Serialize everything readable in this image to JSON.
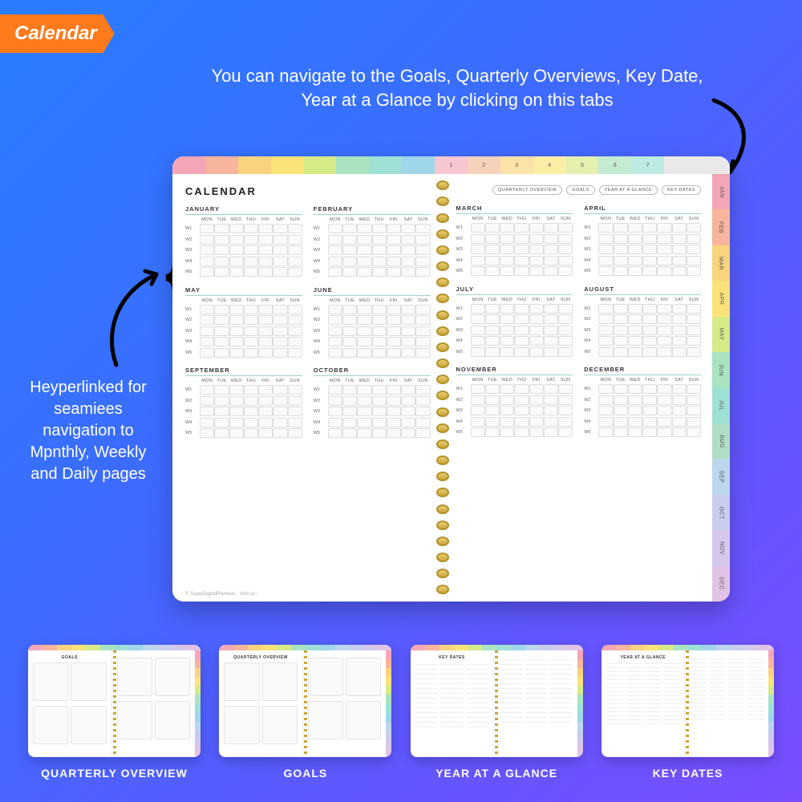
{
  "tag": "Calendar",
  "blurb_top": "You can navigate to the Goals, Quarterly Overviews, Key Date, Year at a Glance by clicking on this tabs",
  "blurb_left": "Heyperlinked for seamiees navigation to Mpnthly, Weekly and Daily pages",
  "planner": {
    "title": "CALENDAR",
    "nav_pills": [
      "QUARTERLY OVERVIEW",
      "GOALS",
      "YEAR AT A GLANCE",
      "KEY DATES"
    ],
    "dow": [
      "MON",
      "TUE",
      "WED",
      "THU",
      "FRI",
      "SAT",
      "SUN"
    ],
    "weeks": [
      "W1",
      "W2",
      "W3",
      "W4",
      "W5"
    ],
    "top_tabs": [
      {
        "color": "#f4a6b7"
      },
      {
        "color": "#f6b59c"
      },
      {
        "color": "#f9d37e"
      },
      {
        "color": "#fbe37a"
      },
      {
        "color": "#d6ea88"
      },
      {
        "color": "#a9e3c0"
      },
      {
        "color": "#9ee0d6"
      },
      {
        "color": "#9fd6ea"
      },
      {
        "color": "#f7c7d1",
        "label": "1"
      },
      {
        "color": "#f7d2bb",
        "label": "2"
      },
      {
        "color": "#fbe2a8",
        "label": "3"
      },
      {
        "color": "#fdeea6",
        "label": "4"
      },
      {
        "color": "#e3f0b0",
        "label": "5"
      },
      {
        "color": "#c4ecd3",
        "label": "6"
      },
      {
        "color": "#bdeae3",
        "label": "7"
      },
      {
        "color": "#e9e9e9"
      },
      {
        "color": "#e9e9e9"
      }
    ],
    "side_tabs": [
      {
        "label": "JAN",
        "color": "#f4a6b7"
      },
      {
        "label": "FEB",
        "color": "#f6b59c"
      },
      {
        "label": "MAR",
        "color": "#f9d37e"
      },
      {
        "label": "APR",
        "color": "#fbe37a"
      },
      {
        "label": "MAY",
        "color": "#d6ea88"
      },
      {
        "label": "JUN",
        "color": "#a9e3c0"
      },
      {
        "label": "JUL",
        "color": "#9ee0d6"
      },
      {
        "label": "AUG",
        "color": "#b0dec5"
      },
      {
        "label": "SEP",
        "color": "#bcd6ec"
      },
      {
        "label": "OCT",
        "color": "#c7cdeb"
      },
      {
        "label": "NOV",
        "color": "#d5c7ea"
      },
      {
        "label": "DEC",
        "color": "#e2c3e6"
      }
    ],
    "left_months": [
      "JANUARY",
      "FEBRUARY",
      "MAY",
      "JUNE",
      "SEPTEMBER",
      "OCTOBER"
    ],
    "right_months": [
      "MARCH",
      "APRIL",
      "JULY",
      "AUGUST",
      "NOVEMBER",
      "DECEMBER"
    ],
    "footer": "© SuperDigitalPlanners · Visit us ›"
  },
  "thumbs": [
    {
      "label": "QUARTERLY OVERVIEW",
      "title_l": "GOALS",
      "title_r": ""
    },
    {
      "label": "GOALS",
      "title_l": "QUARTERLY OVERVIEW",
      "title_r": ""
    },
    {
      "label": "YEAR AT A GLANCE",
      "title_l": "KEY DATES",
      "title_r": ""
    },
    {
      "label": "KEY DATES",
      "title_l": "YEAR AT A GLANCE",
      "title_r": ""
    }
  ],
  "tab_palette": [
    "#f4a6b7",
    "#f6b59c",
    "#f9d37e",
    "#fbe37a",
    "#d6ea88",
    "#a9e3c0",
    "#9ee0d6",
    "#9fd6ea",
    "#bcd6ec",
    "#c7cdeb",
    "#d5c7ea",
    "#e2c3e6"
  ]
}
